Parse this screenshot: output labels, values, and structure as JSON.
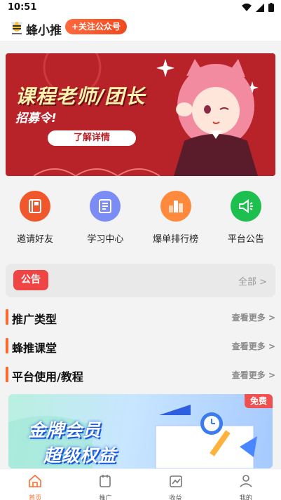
{
  "status": {
    "time": "10:51"
  },
  "app": {
    "title": "蜂小推",
    "follow_label": "+关注公众号"
  },
  "banner": {
    "title": "课程老师/团长",
    "subtitle": "招募令!",
    "button_label": "了解详情"
  },
  "quick_actions": [
    {
      "label": "邀请好友",
      "icon": "book-icon",
      "color": "#f0582c"
    },
    {
      "label": "学习中心",
      "icon": "document-icon",
      "color": "#7b8cf5"
    },
    {
      "label": "爆单排行榜",
      "icon": "chart-icon",
      "color": "#ff8a3d"
    },
    {
      "label": "平台公告",
      "icon": "megaphone-icon",
      "color": "#1dbf4f"
    }
  ],
  "notice": {
    "tag": "公告",
    "more": "全部 >"
  },
  "sections": [
    {
      "title": "推广类型",
      "more": "查看更多 >"
    },
    {
      "title": "蜂推课堂",
      "more": "查看更多 >"
    },
    {
      "title": "平台使用/教程",
      "more": "查看更多 >"
    }
  ],
  "card": {
    "badge": "免费",
    "line1": "金牌会员",
    "line2": "超级权益"
  },
  "tabs": [
    {
      "label": "首页",
      "icon": "home-icon",
      "active": true
    },
    {
      "label": "推广",
      "icon": "promote-icon",
      "active": false
    },
    {
      "label": "收益",
      "icon": "income-icon",
      "active": false
    },
    {
      "label": "我的",
      "icon": "profile-icon",
      "active": false
    }
  ],
  "colors": {
    "accent": "#ff6a2c",
    "banner": "#b8232a",
    "notice_tag": "#f04545"
  }
}
